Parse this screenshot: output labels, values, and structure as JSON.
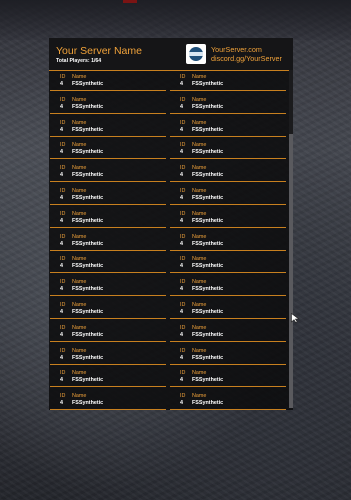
{
  "header": {
    "server_name": "Your Server Name",
    "total_players": "Total Players: 1/64",
    "website": "YourServer.com",
    "discord": "discord.gg/YourServer",
    "logo_icon": "server-logo"
  },
  "columns": {
    "id": "ID",
    "name": "Name"
  },
  "players": [
    {
      "id": "4",
      "name": "FSSynthetic"
    },
    {
      "id": "4",
      "name": "FSSynthetic"
    },
    {
      "id": "4",
      "name": "FSSynthetic"
    },
    {
      "id": "4",
      "name": "FSSynthetic"
    },
    {
      "id": "4",
      "name": "FSSynthetic"
    },
    {
      "id": "4",
      "name": "FSSynthetic"
    },
    {
      "id": "4",
      "name": "FSSynthetic"
    },
    {
      "id": "4",
      "name": "FSSynthetic"
    },
    {
      "id": "4",
      "name": "FSSynthetic"
    },
    {
      "id": "4",
      "name": "FSSynthetic"
    },
    {
      "id": "4",
      "name": "FSSynthetic"
    },
    {
      "id": "4",
      "name": "FSSynthetic"
    },
    {
      "id": "4",
      "name": "FSSynthetic"
    },
    {
      "id": "4",
      "name": "FSSynthetic"
    },
    {
      "id": "4",
      "name": "FSSynthetic"
    },
    {
      "id": "4",
      "name": "FSSynthetic"
    },
    {
      "id": "4",
      "name": "FSSynthetic"
    },
    {
      "id": "4",
      "name": "FSSynthetic"
    },
    {
      "id": "4",
      "name": "FSSynthetic"
    },
    {
      "id": "4",
      "name": "FSSynthetic"
    },
    {
      "id": "4",
      "name": "FSSynthetic"
    },
    {
      "id": "4",
      "name": "FSSynthetic"
    },
    {
      "id": "4",
      "name": "FSSynthetic"
    },
    {
      "id": "4",
      "name": "FSSynthetic"
    },
    {
      "id": "4",
      "name": "FSSynthetic"
    },
    {
      "id": "4",
      "name": "FSSynthetic"
    },
    {
      "id": "4",
      "name": "FSSynthetic"
    },
    {
      "id": "4",
      "name": "FSSynthetic"
    },
    {
      "id": "4",
      "name": "FSSynthetic"
    },
    {
      "id": "4",
      "name": "FSSynthetic"
    }
  ],
  "colors": {
    "accent": "#f0a23a",
    "divider": "#c8801f",
    "panel": "#0c0c0e",
    "text": "#ffffff"
  }
}
